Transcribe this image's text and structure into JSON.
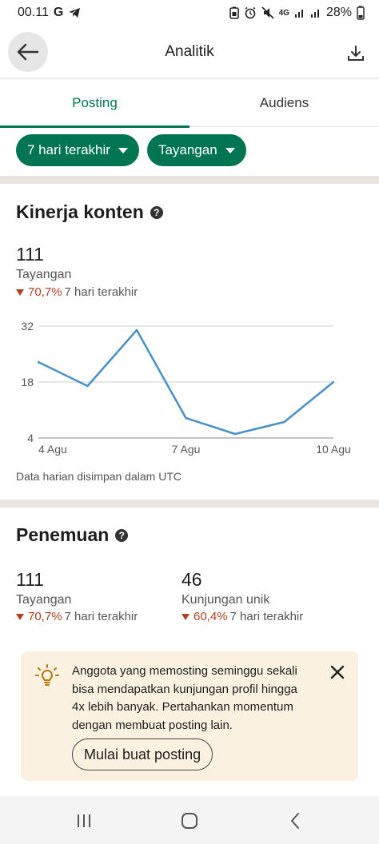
{
  "status": {
    "time": "00.11",
    "carrier_icons": [
      "google-icon",
      "telegram-icon"
    ],
    "network": "4G",
    "battery": "28%"
  },
  "header": {
    "title": "Analitik"
  },
  "tabs": [
    {
      "label": "Posting",
      "active": true
    },
    {
      "label": "Audiens",
      "active": false
    }
  ],
  "filters": [
    {
      "label": "7 hari terakhir"
    },
    {
      "label": "Tayangan"
    }
  ],
  "content_performance": {
    "title": "Kinerja konten",
    "value": "111",
    "label": "Tayangan",
    "change_pct": "70,7%",
    "change_period": "7 hari terakhir",
    "footnote": "Data harian disimpan dalam UTC"
  },
  "chart_data": {
    "type": "line",
    "x": [
      "4 Agu",
      "5 Agu",
      "6 Agu",
      "7 Agu",
      "8 Agu",
      "9 Agu",
      "10 Agu"
    ],
    "x_tick_labels": [
      "4 Agu",
      "7 Agu",
      "10 Agu"
    ],
    "series": [
      {
        "values": [
          23,
          17,
          31,
          9,
          5,
          8,
          18
        ]
      }
    ],
    "ylim": [
      4,
      32
    ],
    "y_ticks": [
      "32",
      "18",
      "4"
    ],
    "grid": true,
    "color": "#4a90c8"
  },
  "discovery": {
    "title": "Penemuan",
    "metrics": [
      {
        "value": "111",
        "label": "Tayangan",
        "change_pct": "70,7%",
        "change_period": "7 hari terakhir"
      },
      {
        "value": "46",
        "label": "Kunjungan unik",
        "change_pct": "60,4%",
        "change_period": "7 hari terakhir"
      }
    ]
  },
  "tip": {
    "text": "Anggota yang memosting seminggu sekali bisa mendapatkan kunjungan profil hingga 4x lebih banyak. Pertahankan momentum dengan membuat posting lain.",
    "button": "Mulai buat posting"
  },
  "colors": {
    "brand_green": "#01754f",
    "decline_red": "#b24020",
    "tip_bg": "#fbf1e0"
  }
}
